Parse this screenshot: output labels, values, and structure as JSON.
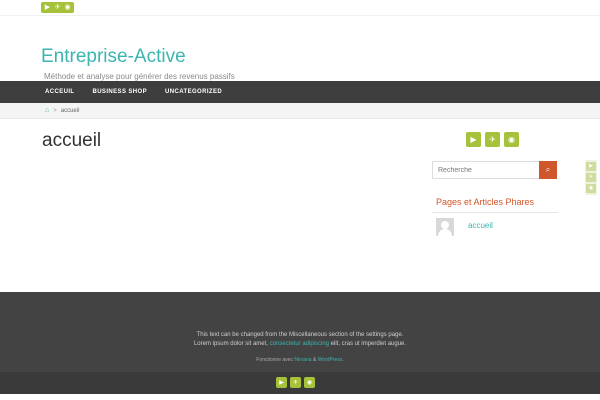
{
  "social": {
    "youtube_glyph": "▶",
    "twitter_glyph": "✈",
    "rss_glyph": "◉"
  },
  "site": {
    "title": "Entreprise-Active",
    "tagline": "Méthode et analyse pour générer des revenus passifs"
  },
  "nav": {
    "items": [
      "ACCEUIL",
      "BUSINESS SHOP",
      "UNCATEGORIZED"
    ]
  },
  "breadcrumb": {
    "home_glyph": "⌂",
    "separator": ">",
    "current": "accueil"
  },
  "page": {
    "title": "accueil"
  },
  "sidebar": {
    "search_placeholder": "Recherche",
    "search_glyph": "⌕",
    "widget_title": "Pages et Articles Phares",
    "widget_link": "accueil"
  },
  "footer": {
    "line1": "This text can be changed from the Miscellaneous section of the settings page.",
    "line2_pre": "Lorem ipsum dolor sit amet, ",
    "line2_link": "consectetur adipiscing",
    "line2_post": " elit, cras ut imperdiet augue.",
    "powered_pre": "Fonctionne avec ",
    "powered_link1": "Nirvana",
    "powered_mid": " & ",
    "powered_link2": "WordPress",
    "powered_post": "."
  },
  "colors": {
    "accent": "#3cb5b0",
    "social_green": "#a6c23a",
    "orange": "#d0562b",
    "nav_bg": "#3e3e3e",
    "footer_bg": "#434343"
  }
}
